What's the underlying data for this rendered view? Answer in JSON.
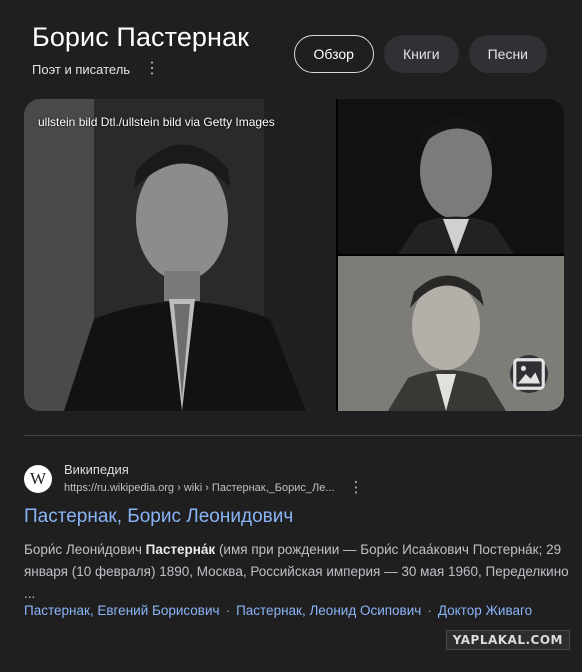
{
  "header": {
    "title": "Борис Пастернак",
    "subtitle": "Поэт и писатель",
    "tabs": [
      {
        "label": "Обзор",
        "active": true
      },
      {
        "label": "Книги",
        "active": false
      },
      {
        "label": "Песни",
        "active": false
      }
    ]
  },
  "gallery": {
    "credit": "ullstein bild Dtl./ullstein bild via Getty Images",
    "image_button_icon": "image-icon"
  },
  "result": {
    "site_name": "Википедия",
    "favicon_letter": "W",
    "url": "https://ru.wikipedia.org › wiki › Пастернак,_Борис_Ле...",
    "title": "Пастернак, Борис Леонидович",
    "snippet": {
      "before": "Бори́с Леони́дович ",
      "bold": "Пастерна́к",
      "after": " (имя при рождении — Бори́с Исаа́кович Постерна́к; 29 января (10 февраля) 1890, Москва, Российская империя — 30 мая 1960, Переделкино ..."
    },
    "links": [
      "Пастернак, Евгений Борисович",
      "Пастернак, Леонид Осипович",
      "Доктор Живаго"
    ],
    "link_separator": "·"
  },
  "watermark": "YAPLAKAL.COM",
  "colors": {
    "background": "#1f1f1f",
    "link": "#8ab4f8",
    "chip": "#303134",
    "text": "#e3e3e3"
  }
}
